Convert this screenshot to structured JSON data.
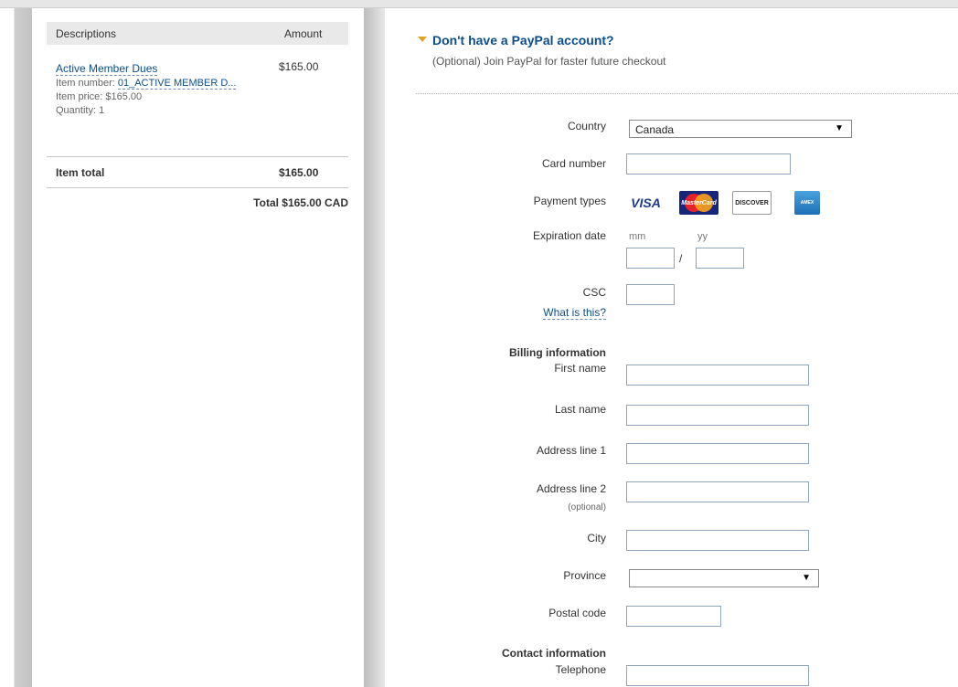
{
  "summary": {
    "header": {
      "description": "Descriptions",
      "amount": "Amount"
    },
    "item": {
      "name": "Active Member Dues",
      "amount": "$165.00",
      "number_label": "Item number: ",
      "number_value": "01_ACTIVE MEMBER D...",
      "price": "Item price: $165.00",
      "quantity": "Quantity: 1"
    },
    "item_total_label": "Item total",
    "item_total_value": "$165.00",
    "grand_total": "Total $165.00 CAD"
  },
  "signup": {
    "heading": "Don't have a PayPal account?",
    "subtext": "(Optional) Join PayPal for faster future checkout"
  },
  "form": {
    "country_label": "Country",
    "country_value": "Canada",
    "card_number_label": "Card number",
    "payment_types_label": "Payment types",
    "payment_types": {
      "visa": "VISA",
      "mastercard": "MasterCard",
      "discover": "DISCOVER",
      "amex": "AMEX"
    },
    "expiration_label": "Expiration date",
    "mm_label": "mm",
    "yy_label": "yy",
    "slash": "/",
    "csc_label": "CSC",
    "csc_help": "What is this?",
    "billing_heading": "Billing information",
    "first_name_label": "First name",
    "last_name_label": "Last name",
    "address1_label": "Address line 1",
    "address2_label": "Address line 2",
    "address2_optional": "(optional)",
    "city_label": "City",
    "province_label": "Province",
    "province_value": "",
    "postal_label": "Postal code",
    "contact_heading": "Contact information",
    "telephone_label": "Telephone"
  },
  "icons": {
    "dropdown": "down-arrow-icon",
    "disclosure": "triangle-down-icon"
  },
  "colors": {
    "link": "#0b4e8c",
    "accent_triangle": "#e6a023"
  }
}
